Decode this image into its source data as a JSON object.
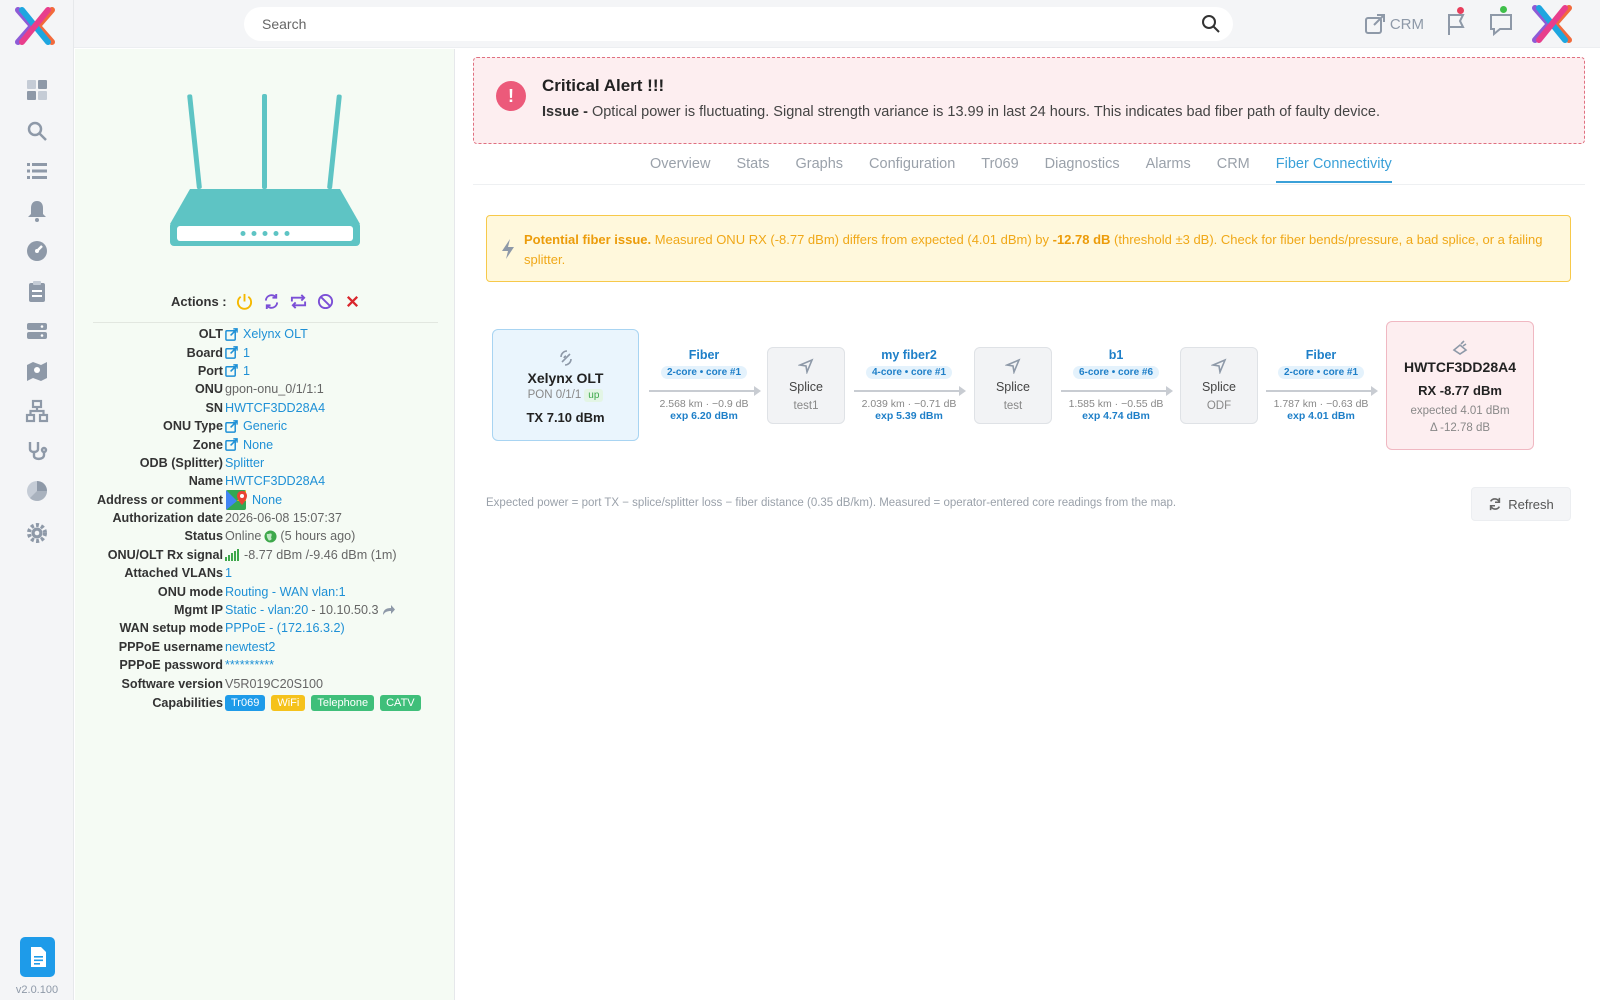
{
  "app": {
    "version": "v2.0.100"
  },
  "sidebar": {
    "items": [
      {
        "icon": "dashboard-icon"
      },
      {
        "icon": "search-icon"
      },
      {
        "icon": "list-icon"
      },
      {
        "icon": "bell-icon"
      },
      {
        "icon": "gauge-icon"
      },
      {
        "icon": "clipboard-icon"
      },
      {
        "icon": "server-icon"
      },
      {
        "icon": "map-icon"
      },
      {
        "icon": "network-icon"
      },
      {
        "icon": "stethoscope-icon"
      },
      {
        "icon": "pie-chart-icon"
      },
      {
        "icon": "gear-icon"
      }
    ]
  },
  "topbar": {
    "search_placeholder": "Search",
    "crm_label": "CRM"
  },
  "device": {
    "actions_label": "Actions :",
    "fields": {
      "olt": {
        "label": "OLT",
        "value": "Xelynx OLT"
      },
      "board": {
        "label": "Board",
        "value": "1"
      },
      "port": {
        "label": "Port",
        "value": "1"
      },
      "onu": {
        "label": "ONU",
        "value": "gpon-onu_0/1/1:1"
      },
      "sn": {
        "label": "SN",
        "value": "HWTCF3DD28A4"
      },
      "onu_type": {
        "label": "ONU Type",
        "value": "Generic"
      },
      "zone": {
        "label": "Zone",
        "value": "None"
      },
      "odb": {
        "label": "ODB (Splitter)",
        "value": "Splitter"
      },
      "name": {
        "label": "Name",
        "value": "HWTCF3DD28A4"
      },
      "address": {
        "label": "Address or comment",
        "value": "None"
      },
      "auth_date": {
        "label": "Authorization date",
        "value": "2026-06-08 15:07:37"
      },
      "status": {
        "label": "Status",
        "value": "Online",
        "extra": "(5 hours ago)"
      },
      "rx_signal": {
        "label": "ONU/OLT Rx signal",
        "value": "-8.77 dBm /-9.46 dBm (1m)"
      },
      "vlans": {
        "label": "Attached VLANs",
        "value": "1"
      },
      "onu_mode": {
        "label": "ONU mode",
        "value": "Routing - WAN vlan:1"
      },
      "mgmt_ip": {
        "label": "Mgmt IP",
        "value": "Static - vlan:20",
        "extra": "- 10.10.50.3"
      },
      "wan_mode": {
        "label": "WAN setup mode",
        "value": "PPPoE - (172.16.3.2)"
      },
      "pppoe_user": {
        "label": "PPPoE username",
        "value": "newtest2"
      },
      "pppoe_pass": {
        "label": "PPPoE password",
        "value": "**********"
      },
      "software": {
        "label": "Software version",
        "value": "V5R019C20S100"
      },
      "capabilities": {
        "label": "Capabilities"
      }
    },
    "capabilities": [
      {
        "label": "Tr069",
        "color": "#1e9be9"
      },
      {
        "label": "WiFi",
        "color": "#f5c21b"
      },
      {
        "label": "Telephone",
        "color": "#3fbf7a"
      },
      {
        "label": "CATV",
        "color": "#3fbf7a"
      }
    ]
  },
  "alert": {
    "title": "Critical Alert !!!",
    "issue_label": "Issue -",
    "issue_text": "Optical power is fluctuating. Signal strength variance is 13.99 in last 24 hours. This indicates bad fiber path of faulty device."
  },
  "tabs": [
    {
      "label": "Overview",
      "active": false
    },
    {
      "label": "Stats",
      "active": false
    },
    {
      "label": "Graphs",
      "active": false
    },
    {
      "label": "Configuration",
      "active": false
    },
    {
      "label": "Tr069",
      "active": false
    },
    {
      "label": "Diagnostics",
      "active": false
    },
    {
      "label": "Alarms",
      "active": false
    },
    {
      "label": "CRM",
      "active": false
    },
    {
      "label": "Fiber Connectivity",
      "active": true
    }
  ],
  "warning": {
    "bold1": "Potential fiber issue.",
    "text1": " Measured ONU RX (-8.77 dBm) differs from expected (4.01 dBm) by ",
    "bold2": "-12.78 dB",
    "text2": " (threshold ±3 dB). Check for fiber bends/pressure, a bad splice, or a failing splitter."
  },
  "fiber_path": {
    "olt": {
      "name": "Xelynx OLT",
      "pon": "PON 0/1/1",
      "status": "up",
      "tx": "TX 7.10 dBm"
    },
    "segments": [
      {
        "name": "Fiber",
        "core": "2-core • core #1",
        "meta": "2.568 km · −0.9 dB",
        "exp": "exp 6.20 dBm"
      },
      {
        "name": "my fiber2",
        "core": "4-core • core #1",
        "meta": "2.039 km · −0.71 dB",
        "exp": "exp 5.39 dBm"
      },
      {
        "name": "b1",
        "core": "6-core • core #6",
        "meta": "1.585 km · −0.55 dB",
        "exp": "exp 4.74 dBm"
      },
      {
        "name": "Fiber",
        "core": "2-core • core #1",
        "meta": "1.787 km · −0.63 dB",
        "exp": "exp 4.01 dBm"
      }
    ],
    "splices": [
      {
        "label": "Splice",
        "name": "test1"
      },
      {
        "label": "Splice",
        "name": "test"
      },
      {
        "label": "Splice",
        "name": "ODF"
      }
    ],
    "onu": {
      "name": "HWTCF3DD28A4",
      "rx": "RX -8.77 dBm",
      "expected": "expected 4.01 dBm",
      "delta": "Δ -12.78 dB"
    }
  },
  "footnote": "Expected power = port TX − splice/splitter loss − fiber distance (0.35 dB/km). Measured = operator-entered core readings from the map.",
  "refresh_label": "Refresh"
}
